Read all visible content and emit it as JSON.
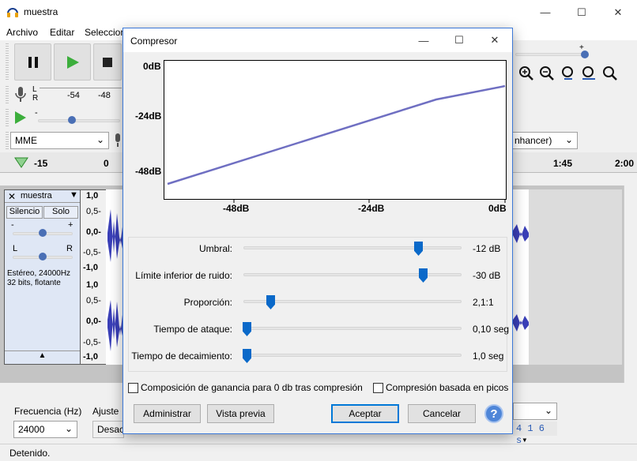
{
  "app": {
    "title": "muestra",
    "menu": [
      "Archivo",
      "Editar",
      "Seleccion"
    ],
    "status": "Detenido."
  },
  "toolbar": {
    "meter_ticks": [
      "-54",
      "-48"
    ],
    "lr_labels": [
      "L",
      "R"
    ],
    "host_value": "MME",
    "effect_value": "nhancer)",
    "timeline": [
      "-15",
      "0",
      "1:45",
      "2:00"
    ]
  },
  "track": {
    "name": "muestra",
    "mute_label": "Silencio",
    "solo_label": "Solo",
    "gain_minus": "-",
    "gain_plus": "+",
    "pan_l": "L",
    "pan_r": "R",
    "info_line1": "Estéreo, 24000Hz",
    "info_line2": "32 bits, flotante",
    "scale_top": [
      "1,0",
      "0,5-",
      "0,0-",
      "-0,5-",
      "-1,0"
    ],
    "scale_bottom": [
      "1,0",
      "0,5-",
      "0,0-",
      "-0,5-",
      "-1,0"
    ]
  },
  "bottom": {
    "freq_label": "Frecuencia (Hz)",
    "adjust_label": "Ajuste",
    "freq_value": "24000",
    "snap_value": "Desac",
    "time_digits": "4 1 6 s"
  },
  "dialog": {
    "title": "Compresor",
    "plot": {
      "y_ticks": [
        "0dB",
        "-24dB",
        "-48dB"
      ],
      "x_ticks": [
        "-48dB",
        "-24dB",
        "0dB"
      ],
      "line_color": "#6f6fc2"
    },
    "params": [
      {
        "label": "Umbral:",
        "value": "-12 dB",
        "level": 0.82
      },
      {
        "label": "Límite inferior de ruido:",
        "value": "-30 dB",
        "level": 0.84
      },
      {
        "label": "Proporción:",
        "value": "2,1:1",
        "level": 0.12
      },
      {
        "label": "Tiempo de ataque:",
        "value": "0,10 seg",
        "level": 0.0
      },
      {
        "label": "Tiempo de decaimiento:",
        "value": "1,0 seg",
        "level": 0.0
      }
    ],
    "check_makeup": "Composición de ganancia para 0 db tras compresión",
    "check_peak": "Compresión basada en picos",
    "btn_manage": "Administrar",
    "btn_preview": "Vista previa",
    "btn_ok": "Aceptar",
    "btn_cancel": "Cancelar",
    "btn_help": "?"
  }
}
